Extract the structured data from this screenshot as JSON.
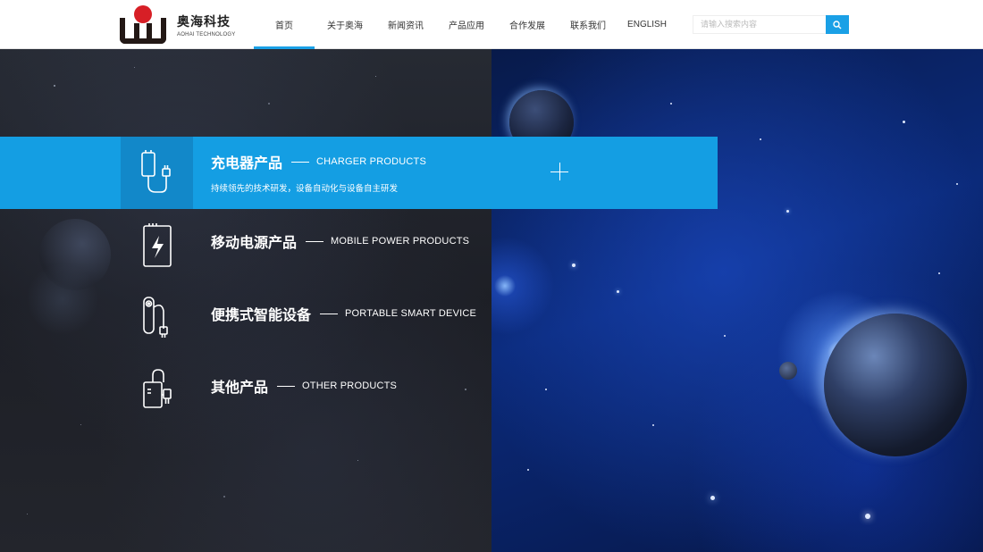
{
  "header": {
    "logo_cn": "奥海科技",
    "logo_en": "AOHAI TECHNOLOGY",
    "nav": [
      {
        "label": "首页",
        "active": true
      },
      {
        "label": "关于奥海",
        "active": false
      },
      {
        "label": "新闻资讯",
        "active": false
      },
      {
        "label": "产品应用",
        "active": false
      },
      {
        "label": "合作发展",
        "active": false
      },
      {
        "label": "联系我们",
        "active": false
      },
      {
        "label": "ENGLISH",
        "active": false
      }
    ],
    "search": {
      "placeholder": "请输入搜索内容"
    }
  },
  "products": [
    {
      "title_cn": "充电器产品",
      "title_en": "CHARGER PRODUCTS",
      "desc": "持续领先的技术研发，设备自动化与设备自主研发",
      "icon": "charger-icon",
      "active": true
    },
    {
      "title_cn": "移动电源产品",
      "title_en": "MOBILE POWER PRODUCTS",
      "desc": "",
      "icon": "power-bank-icon",
      "active": false
    },
    {
      "title_cn": "便携式智能设备",
      "title_en": "PORTABLE SMART DEVICE",
      "desc": "",
      "icon": "smart-device-icon",
      "active": false
    },
    {
      "title_cn": "其他产品",
      "title_en": "OTHER PRODUCTS",
      "desc": "",
      "icon": "other-products-icon",
      "active": false
    }
  ],
  "colors": {
    "accent": "#149ee3",
    "accent_dark": "#1288c9",
    "logo_red": "#d71f26"
  }
}
